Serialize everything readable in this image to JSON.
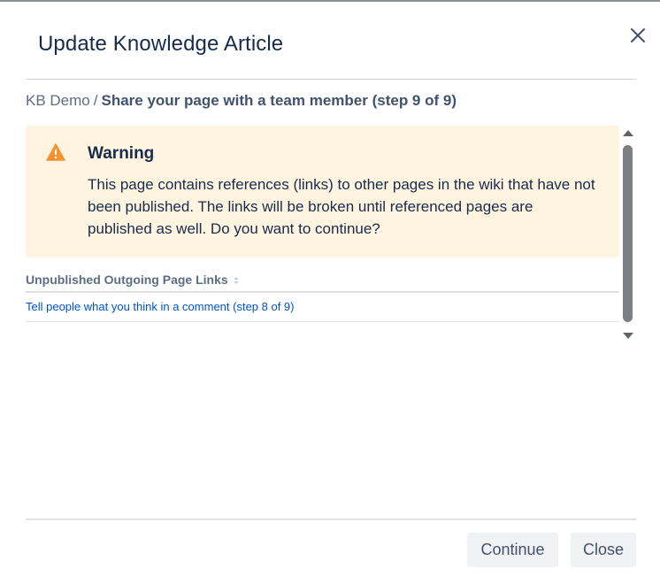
{
  "dialog": {
    "title": "Update Knowledge Article"
  },
  "breadcrumb": {
    "space": "KB Demo",
    "separator": "/",
    "page": "Share your page with a team member (step 9 of 9)"
  },
  "warning": {
    "icon": "warning-triangle-icon",
    "icon_color": "#f79232",
    "title": "Warning",
    "message": "This page contains references (links) to other pages in the wiki that have not been published. The links will be broken until referenced pages are published as well. Do you want to continue?"
  },
  "links_table": {
    "header": "Unpublished Outgoing Page Links",
    "rows": [
      "Tell people what you think in a comment (step 8 of 9)"
    ]
  },
  "footer": {
    "continue_label": "Continue",
    "close_label": "Close"
  },
  "colors": {
    "warning_bg": "#fff4e0",
    "link": "#0052cc",
    "title": "#172b4d"
  }
}
